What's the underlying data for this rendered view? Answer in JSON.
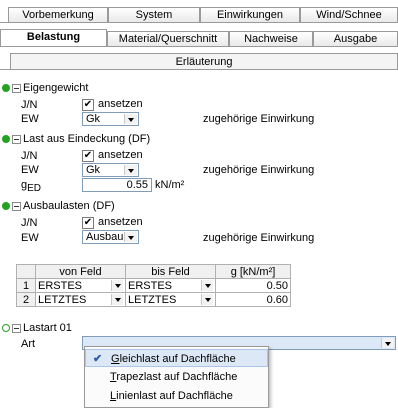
{
  "tabs_row1": [
    "Vorbemerkung",
    "System",
    "Einwirkungen",
    "Wind/Schnee"
  ],
  "tabs_row2": [
    "Belastung",
    "Material/Querschnitt",
    "Nachweise",
    "Ausgabe"
  ],
  "panel_title": "Erläuterung",
  "eigengewicht": {
    "title": "Eigengewicht",
    "jn_label": "J/N",
    "jn_text": "ansetzen",
    "ew_label": "EW",
    "ew_value": "Gk",
    "ew_note": "zugehörige Einwirkung"
  },
  "last_eindeckung": {
    "title": "Last aus Eindeckung (DF)",
    "jn_label": "J/N",
    "jn_text": "ansetzen",
    "ew_label": "EW",
    "ew_value": "Gk",
    "ew_note": "zugehörige Einwirkung",
    "ged_label": "g",
    "ged_sub": "ED",
    "ged_value": "0.55",
    "ged_unit": "kN/m²"
  },
  "ausbaulasten": {
    "title": "Ausbaulasten (DF)",
    "jn_label": "J/N",
    "jn_text": "ansetzen",
    "ew_label": "EW",
    "ew_value": "Ausbau",
    "ew_note": "zugehörige Einwirkung"
  },
  "table": {
    "headers": [
      "",
      "von Feld",
      "bis Feld",
      "g [kN/m²]"
    ],
    "rows": [
      {
        "num": "1",
        "von": "ERSTES",
        "bis": "ERSTES",
        "g": "0.50"
      },
      {
        "num": "2",
        "von": "LETZTES",
        "bis": "LETZTES",
        "g": "0.60"
      }
    ]
  },
  "lastart": {
    "title": "Lastart 01",
    "art_label": "Art",
    "art_value": ""
  },
  "dropdown": {
    "items": [
      {
        "accel": "G",
        "rest": "leichlast auf Dachfläche",
        "selected": true
      },
      {
        "accel": "T",
        "rest": "rapezlast auf Dachfläche",
        "selected": false
      },
      {
        "accel": "L",
        "rest": "inienlast auf Dachfläche",
        "selected": false
      }
    ]
  },
  "colors": {
    "active_dot": "#22a322",
    "selection": "#dde8f6",
    "check": "#2a5caa"
  }
}
